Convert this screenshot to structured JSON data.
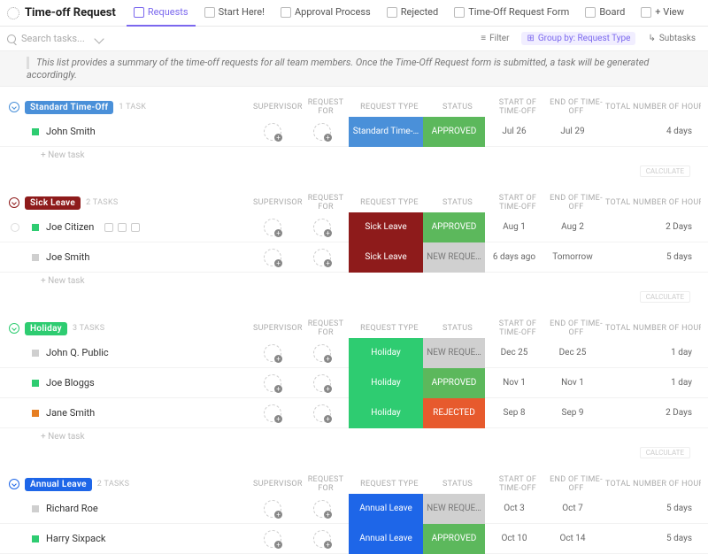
{
  "header": {
    "title": "Time-off Request",
    "tabs": [
      {
        "label": "Requests",
        "active": true
      },
      {
        "label": "Start Here!"
      },
      {
        "label": "Approval Process"
      },
      {
        "label": "Rejected"
      },
      {
        "label": "Time-Off Request Form"
      },
      {
        "label": "Board"
      },
      {
        "label": "+ View"
      }
    ]
  },
  "toolbar": {
    "search_placeholder": "Search tasks...",
    "filter": "Filter",
    "group_by": "Group by: Request Type",
    "subtasks": "Subtasks"
  },
  "description": "This list provides a summary of the time-off requests for all team members. Once the Time-Off Request form is submitted, a task will be generated accordingly.",
  "columns": {
    "supervisor": "SUPERVISOR",
    "request_for": "REQUEST FOR",
    "request_type": "REQUEST TYPE",
    "status": "STATUS",
    "start": "START OF TIME-OFF",
    "end": "END OF TIME-OFF",
    "total": "TOTAL NUMBER OF HOURS"
  },
  "new_task": "+ New task",
  "calculate": "CALCULATE",
  "groups": [
    {
      "name": "Standard Time-Off",
      "pill_color": "#4a90d9",
      "toggle_color": "#4a90d9",
      "count": "1 TASK",
      "rows": [
        {
          "sq": "#2ecc71",
          "name": "John Smith",
          "rtype": "Standard Time-…",
          "rtype_bg": "#4a90d9",
          "status": "APPROVED",
          "status_bg": "#5cb85c",
          "start": "Jul 26",
          "end": "Jul 29",
          "dur": "4 days"
        }
      ]
    },
    {
      "name": "Sick Leave",
      "pill_color": "#8e1b1b",
      "toggle_color": "#8e1b1b",
      "count": "2 TASKS",
      "rows": [
        {
          "sq": "#2ecc71",
          "name": "Joe Citizen",
          "icons": true,
          "dot": true,
          "rtype": "Sick Leave",
          "rtype_bg": "#8e1b1b",
          "status": "APPROVED",
          "status_bg": "#5cb85c",
          "start": "Aug 1",
          "end": "Aug 2",
          "dur": "2 Days"
        },
        {
          "sq": "#cfcfcf",
          "name": "Joe Smith",
          "rtype": "Sick Leave",
          "rtype_bg": "#8e1b1b",
          "status": "NEW REQUE…",
          "status_bg": "gray",
          "start": "6 days ago",
          "end": "Tomorrow",
          "dur": "5 days"
        }
      ]
    },
    {
      "name": "Holiday",
      "pill_color": "#2ecc71",
      "toggle_color": "#2ecc71",
      "count": "3 TASKS",
      "rows": [
        {
          "sq": "#cfcfcf",
          "name": "John Q. Public",
          "rtype": "Holiday",
          "rtype_bg": "#2ecc71",
          "status": "NEW REQUE…",
          "status_bg": "gray",
          "start": "Dec 25",
          "end": "Dec 25",
          "dur": "1 day"
        },
        {
          "sq": "#2ecc71",
          "name": "Joe Bloggs",
          "rtype": "Holiday",
          "rtype_bg": "#2ecc71",
          "status": "APPROVED",
          "status_bg": "#5cb85c",
          "start": "Nov 1",
          "end": "Nov 1",
          "dur": "1 day"
        },
        {
          "sq": "#e67e22",
          "name": "Jane Smith",
          "rtype": "Holiday",
          "rtype_bg": "#2ecc71",
          "status": "REJECTED",
          "status_bg": "#e75a2d",
          "start": "Sep 8",
          "end": "Sep 9",
          "dur": "2 Days"
        }
      ]
    },
    {
      "name": "Annual Leave",
      "pill_color": "#1e66e8",
      "toggle_color": "#1e66e8",
      "count": "2 TASKS",
      "rows": [
        {
          "sq": "#cfcfcf",
          "name": "Richard Roe",
          "rtype": "Annual Leave",
          "rtype_bg": "#1e66e8",
          "status": "NEW REQUE…",
          "status_bg": "gray",
          "start": "Oct 3",
          "end": "Oct 7",
          "dur": "5 days"
        },
        {
          "sq": "#2ecc71",
          "name": "Harry Sixpack",
          "rtype": "Annual Leave",
          "rtype_bg": "#1e66e8",
          "status": "APPROVED",
          "status_bg": "#5cb85c",
          "start": "Oct 10",
          "end": "Oct 14",
          "dur": "5 days"
        }
      ]
    }
  ]
}
